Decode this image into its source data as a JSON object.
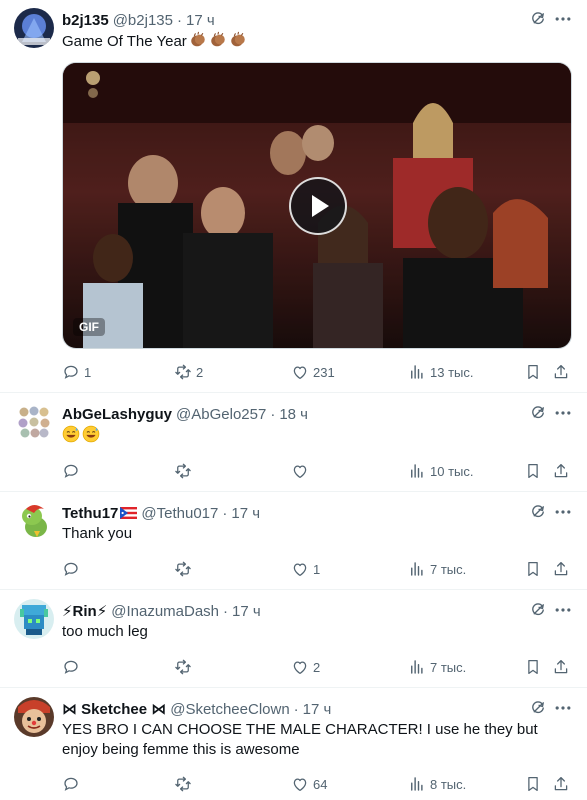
{
  "colors": {
    "text": "#0f1419",
    "secondary": "#536471",
    "divider": "#eff3f4"
  },
  "posts": [
    {
      "name": "b2j135",
      "handle": "@b2j135",
      "time": "17 ч",
      "text": "Game Of The Year",
      "emojis": [
        "clapping-hands",
        "clapping-hands",
        "clapping-hands"
      ],
      "media": {
        "badge": "GIF",
        "kind": "animated-gif"
      },
      "stats": {
        "replies": "1",
        "reposts": "2",
        "likes": "231",
        "views": "13 тыс."
      }
    },
    {
      "name": "AbGeLashyguy",
      "handle": "@AbGelo257",
      "time": "18 ч",
      "text": "",
      "emojis": [
        "sweat-smile-face",
        "sweat-smile-face"
      ],
      "stats": {
        "replies": "",
        "reposts": "",
        "likes": "",
        "views": "10 тыс."
      }
    },
    {
      "name": "Tethu17",
      "handle": "@Tethu017",
      "time": "17 ч",
      "text": "Thank you",
      "flag": "puerto-rico-flag",
      "stats": {
        "replies": "",
        "reposts": "",
        "likes": "1",
        "views": "7 тыс."
      }
    },
    {
      "name": "⚡Rin⚡",
      "handle": "@InazumaDash",
      "time": "17 ч",
      "text": "too much leg",
      "stats": {
        "replies": "",
        "reposts": "",
        "likes": "2",
        "views": "7 тыс."
      }
    },
    {
      "name": "⋈ Sketchee ⋈",
      "handle": "@SketcheeClown",
      "time": "17 ч",
      "text": "YES BRO I CAN CHOOSE THE MALE CHARACTER! I use he they but enjoy being femme this is awesome",
      "stats": {
        "replies": "",
        "reposts": "",
        "likes": "64",
        "views": "8 тыс."
      }
    }
  ]
}
